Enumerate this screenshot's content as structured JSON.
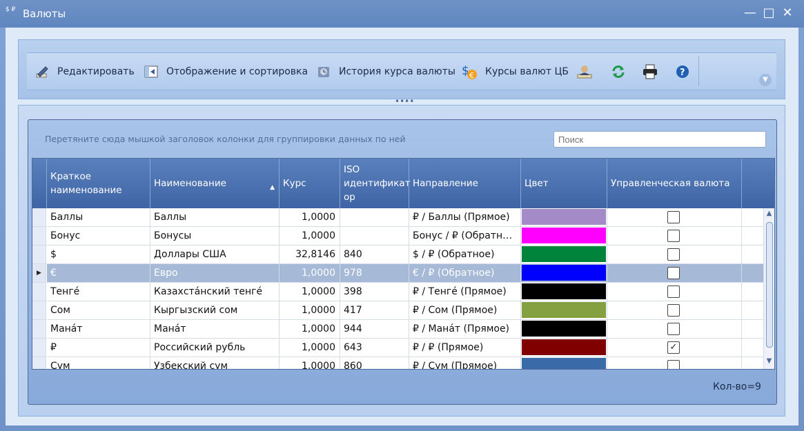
{
  "window": {
    "title": "Валюты",
    "icon_text": "$ ₽"
  },
  "toolbar": {
    "edit_label": "Редактировать",
    "display_label": "Отображение и сортировка",
    "history_label": "История курса валюты",
    "cb_rates_label": "Курсы валют ЦБ"
  },
  "grid": {
    "group_hint": "Перетяните сюда мышкой заголовок колонки для группировки данных по ней",
    "search_placeholder": "Поиск",
    "columns": {
      "short_name": "Краткое наименование",
      "name": "Наименование",
      "rate": "Курс",
      "iso": "ISO идентификат ор",
      "direction": "Направление",
      "color": "Цвет",
      "managerial": "Управленческая валюта"
    },
    "rows": [
      {
        "short": "Баллы",
        "name": "Баллы",
        "rate": "1,0000",
        "iso": "",
        "direction": "₽ / Баллы   (Прямое)",
        "color": "#a58ac8",
        "managerial": false
      },
      {
        "short": "Бонус",
        "name": "Бонусы",
        "rate": "1,0000",
        "iso": "",
        "direction": "Бонус / ₽   (Обратн…",
        "color": "#ff00ff",
        "managerial": false
      },
      {
        "short": "$",
        "name": "Доллары США",
        "rate": "32,8146",
        "iso": "840",
        "direction": "$ / ₽   (Обратное)",
        "color": "#00843c",
        "managerial": false
      },
      {
        "short": "€",
        "name": "Евро",
        "rate": "1,0000",
        "iso": "978",
        "direction": "€ / ₽   (Обратное)",
        "color": "#0000ff",
        "managerial": false
      },
      {
        "short": "Тенгé",
        "name": "Казахстáнский тенгé",
        "rate": "1,0000",
        "iso": "398",
        "direction": "₽ / Тенгé   (Прямое)",
        "color": "#000000",
        "managerial": false
      },
      {
        "short": "Сом",
        "name": "Кыргызский сом",
        "rate": "1,0000",
        "iso": "417",
        "direction": "₽ / Сом   (Прямое)",
        "color": "#84a040",
        "managerial": false
      },
      {
        "short": "Манáт",
        "name": "Манáт",
        "rate": "1,0000",
        "iso": "944",
        "direction": "₽ / Манáт   (Прямое)",
        "color": "#000000",
        "managerial": false
      },
      {
        "short": "₽",
        "name": "Российский рубль",
        "rate": "1,0000",
        "iso": "643",
        "direction": "₽ / ₽   (Прямое)",
        "color": "#800000",
        "managerial": true
      },
      {
        "short": "Сум",
        "name": "Узбекский сум",
        "rate": "1,0000",
        "iso": "860",
        "direction": "₽ / Сум   (Прямое)",
        "color": "#3a6aa8",
        "managerial": false
      }
    ],
    "selected_index": 3,
    "count_label": "Кол-во=9"
  },
  "icons": {
    "edit": "pencil-icon",
    "display": "columns-icon",
    "history": "globe-history-icon",
    "cb_rates": "currency-icon",
    "user": "user-settings-icon",
    "refresh": "refresh-icon",
    "print": "printer-icon",
    "help": "help-icon"
  }
}
